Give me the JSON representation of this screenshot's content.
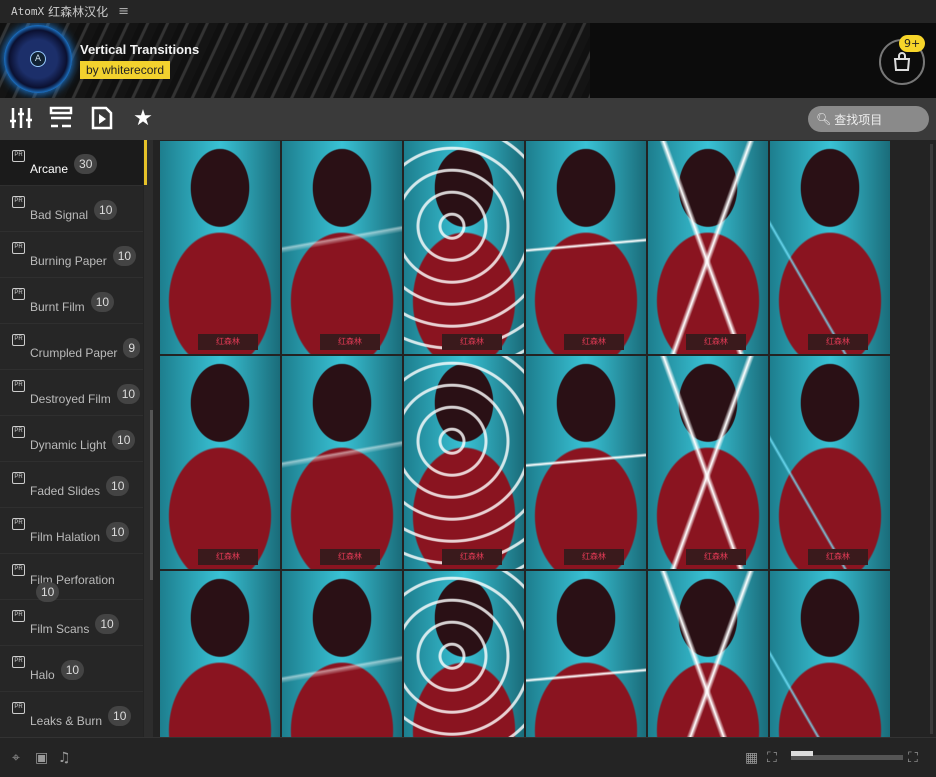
{
  "titlebar": {
    "app": "AtomX",
    "subtitle": "红森林汉化",
    "menu_icon": "hamburger-icon"
  },
  "banner": {
    "title": "Vertical Transitions",
    "author": "by whiterecord",
    "cart_badge": "9+",
    "logo_letter": "A"
  },
  "toolbar": {
    "search_placeholder": "查找项目"
  },
  "sidebar": {
    "items": [
      {
        "label": "Arcane",
        "count": "30",
        "active": true
      },
      {
        "label": "Bad Signal",
        "count": "10"
      },
      {
        "label": "Burning Paper",
        "count": "10"
      },
      {
        "label": "Burnt Film",
        "count": "10"
      },
      {
        "label": "Crumpled Paper",
        "count": "9"
      },
      {
        "label": "Destroyed Film",
        "count": "10"
      },
      {
        "label": "Dynamic Light",
        "count": "10"
      },
      {
        "label": "Faded Slides",
        "count": "10"
      },
      {
        "label": "Film Halation",
        "count": "10"
      },
      {
        "label": "Film Perforation",
        "count": "10"
      },
      {
        "label": "Film Scans",
        "count": "10"
      },
      {
        "label": "Halo",
        "count": "10"
      },
      {
        "label": "Leaks & Burn",
        "count": "10"
      }
    ],
    "file_badge": "PR"
  },
  "grid": {
    "watermark": "红森林",
    "count": 18
  },
  "footer": {
    "zoom_level": 0.2
  },
  "colors": {
    "accent": "#f2d22e",
    "toolbar": "#3a3a3a"
  }
}
